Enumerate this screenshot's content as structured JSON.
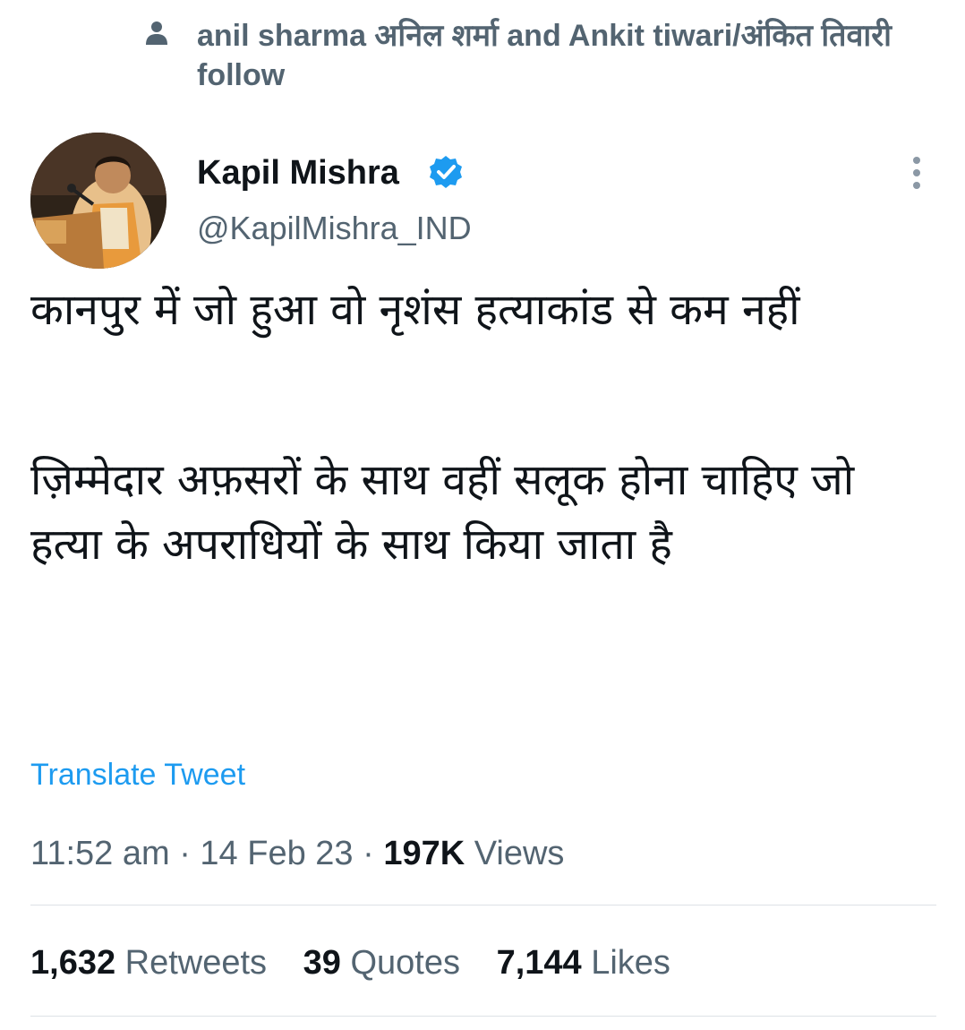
{
  "social_context": {
    "text": "anil sharma अनिल शर्मा and Ankit tiwari/अंकित तिवारी follow",
    "icon": "person-icon"
  },
  "author": {
    "name": "Kapil Mishra",
    "handle": "@KapilMishra_IND",
    "verified": true,
    "verified_color": "#1d9bf0"
  },
  "tweet": {
    "paragraph_1": "कानपुर में जो हुआ वो नृशंस हत्याकांड से कम नहीं",
    "paragraph_2": "ज़िम्मेदार अफ़सरों के साथ वहीं सलूक होना चाहिए जो हत्या के अपराधियों के साथ किया जाता है"
  },
  "translate_label": "Translate Tweet",
  "meta": {
    "time": "11:52 am",
    "separator": "·",
    "date": "14 Feb 23",
    "views_count": "197K",
    "views_label": "Views"
  },
  "stats": {
    "retweets_count": "1,632",
    "retweets_label": "Retweets",
    "quotes_count": "39",
    "quotes_label": "Quotes",
    "likes_count": "7,144",
    "likes_label": "Likes"
  },
  "colors": {
    "accent": "#1d9bf0",
    "text_primary": "#0f1419",
    "text_secondary": "#536471",
    "divider": "#dde2e6"
  }
}
